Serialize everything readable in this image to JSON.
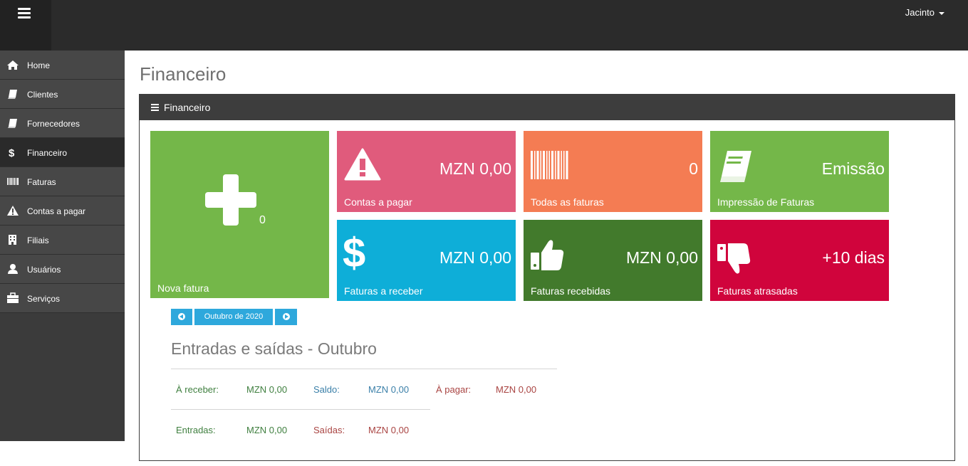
{
  "topbar": {
    "user_name": "Jacinto"
  },
  "sidebar": {
    "items": [
      {
        "label": "Home",
        "icon": "home-icon"
      },
      {
        "label": "Clientes",
        "icon": "book-icon"
      },
      {
        "label": "Fornecedores",
        "icon": "book-icon"
      },
      {
        "label": "Financeiro",
        "icon": "dollar-icon",
        "active": true
      },
      {
        "label": "Faturas",
        "icon": "barcode-icon"
      },
      {
        "label": "Contas a pagar",
        "icon": "warning-icon"
      },
      {
        "label": "Filiais",
        "icon": "building-icon"
      },
      {
        "label": "Usuários",
        "icon": "user-icon"
      },
      {
        "label": "Serviços",
        "icon": "briefcase-icon"
      }
    ]
  },
  "page": {
    "title": "Financeiro"
  },
  "panel": {
    "title": "Financeiro"
  },
  "tiles": {
    "nova_fatura": {
      "caption": "Nova fatura",
      "count": "0",
      "color": "#74b749",
      "icon": "plus-icon"
    },
    "contas_pagar": {
      "caption": "Contas a pagar",
      "value": "MZN 0,00",
      "color": "#e05b7c",
      "icon": "warning-icon"
    },
    "todas_faturas": {
      "caption": "Todas as faturas",
      "value": "0",
      "color": "#f47c53",
      "icon": "barcode-icon"
    },
    "impressao": {
      "caption": "Impressão de Faturas",
      "value": "Emissão",
      "color": "#74b749",
      "icon": "book-icon"
    },
    "faturas_receber": {
      "caption": "Faturas a receber",
      "value": "MZN 0,00",
      "color": "#0eaed8",
      "icon": "dollar-icon"
    },
    "faturas_recebidas": {
      "caption": "Faturas recebidas",
      "value": "MZN 0,00",
      "color": "#427a2c",
      "icon": "thumbs-up-icon"
    },
    "faturas_atrasadas": {
      "caption": "Faturas atrasadas",
      "value": "+10 dias",
      "color": "#d0043c",
      "icon": "thumbs-down-icon"
    }
  },
  "month_nav": {
    "label": "Outubro de 2020",
    "prev_icon": "arrow-left-circle-icon",
    "next_icon": "arrow-right-circle-icon"
  },
  "summary": {
    "title": "Entradas e saídas - Outubro",
    "a_receber_label": "À receber:",
    "a_receber_value": "MZN 0,00",
    "saldo_label": "Saldo:",
    "saldo_value": "MZN 0,00",
    "a_pagar_label": "À pagar:",
    "a_pagar_value": "MZN 0,00",
    "entradas_label": "Entradas:",
    "entradas_value": "MZN 0,00",
    "saidas_label": "Saídas:",
    "saidas_value": "MZN 0,00"
  }
}
